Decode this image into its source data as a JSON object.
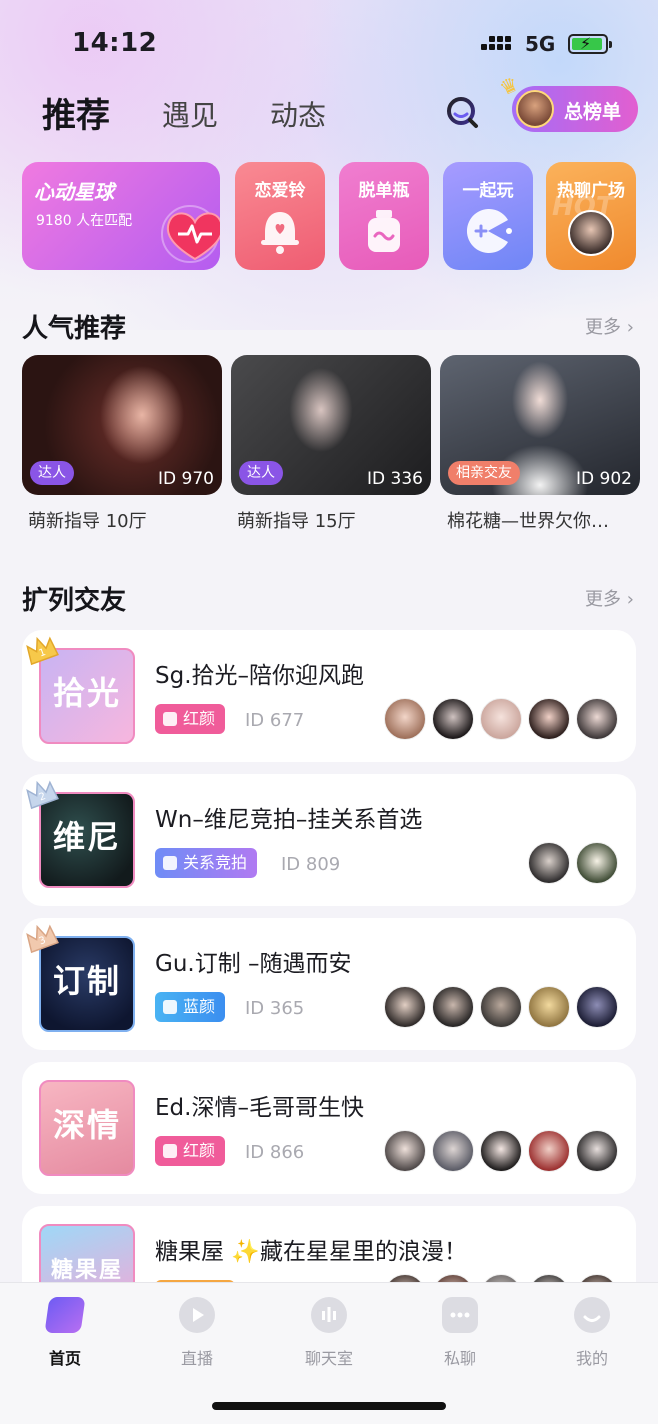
{
  "status_bar": {
    "time": "14:12",
    "network": "5G"
  },
  "header": {
    "tabs": [
      {
        "label": "推荐",
        "active": true
      },
      {
        "label": "遇见",
        "active": false
      },
      {
        "label": "动态",
        "active": false
      }
    ],
    "search_icon": "search-icon",
    "ranking_label": "总榜单"
  },
  "features": [
    {
      "title": "心动星球",
      "subtitle": "9180 人在匹配",
      "icon": "heart-icon"
    },
    {
      "title": "恋爱铃",
      "icon": "bell-icon"
    },
    {
      "title": "脱单瓶",
      "icon": "bottle-icon"
    },
    {
      "title": "一起玩",
      "icon": "game-icon"
    },
    {
      "title": "热聊广场",
      "icon": "avatar",
      "bg_text": "HOT"
    }
  ],
  "popular": {
    "title": "人气推荐",
    "more": "更多",
    "items": [
      {
        "tag": "达人",
        "id": "ID 970",
        "name": "萌新指导 10厅",
        "tag_color": "#8a55e6"
      },
      {
        "tag": "达人",
        "id": "ID 336",
        "name": "萌新指导 15厅",
        "tag_color": "#8a55e6"
      },
      {
        "tag": "相亲交友",
        "id": "ID 902",
        "name": "棉花糖—世界欠你…",
        "tag_color": "#f07f6a"
      }
    ]
  },
  "rooms_section": {
    "title": "扩列交友",
    "more": "更多",
    "rooms": [
      {
        "rank": "1",
        "cover_text": "拾光",
        "title": "Sg.拾光–陪你迎风跑",
        "badge": "红颜",
        "badge_color": "#f05c9a",
        "id": "ID 677",
        "avatar_count": 5
      },
      {
        "rank": "2",
        "cover_text": "维尼",
        "title": "Wn–维尼竞拍–挂关系首选",
        "badge": "关系竞拍",
        "badge_color": "#6f8cf6",
        "id": "ID 809",
        "avatar_count": 2
      },
      {
        "rank": "3",
        "cover_text": "订制",
        "title": "Gu.订制 –随遇而安",
        "badge": "蓝颜",
        "badge_color": "#3aa6f2",
        "id": "ID 365",
        "avatar_count": 5
      },
      {
        "rank": "",
        "cover_text": "深情",
        "title": "Ed.深情–毛哥哥生快",
        "badge": "红颜",
        "badge_color": "#f05c9a",
        "id": "ID 866",
        "avatar_count": 5
      },
      {
        "rank": "",
        "cover_text": "糖果屋",
        "title": "糖果屋 ✨藏在星星里的浪漫！",
        "badge": "",
        "badge_color": "#f5a742",
        "id": "",
        "avatar_count": 5
      }
    ]
  },
  "tabbar": {
    "items": [
      {
        "label": "首页",
        "active": true,
        "icon": "home-icon"
      },
      {
        "label": "直播",
        "active": false,
        "icon": "play-icon"
      },
      {
        "label": "聊天室",
        "active": false,
        "icon": "chatroom-icon"
      },
      {
        "label": "私聊",
        "active": false,
        "icon": "message-icon"
      },
      {
        "label": "我的",
        "active": false,
        "icon": "profile-icon"
      }
    ]
  }
}
